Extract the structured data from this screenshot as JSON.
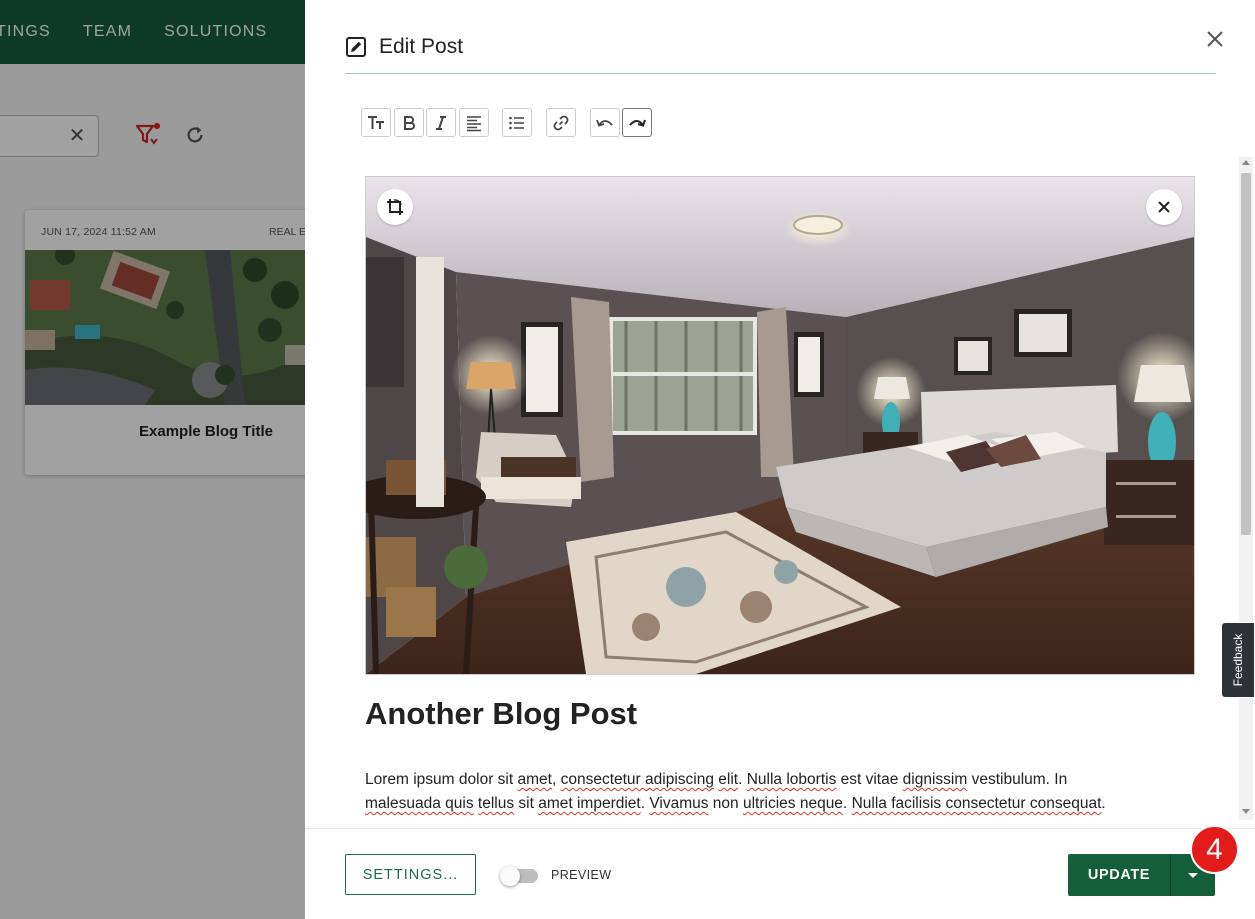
{
  "nav": {
    "items": [
      "TINGS",
      "TEAM",
      "SOLUTIONS"
    ]
  },
  "card": {
    "date": "JUN 17, 2024 11:52 AM",
    "category": "REAL E",
    "title": "Example Blog Title"
  },
  "editor": {
    "title": "Edit Post",
    "toolbar": [
      "text-size-icon",
      "bold-icon",
      "italic-icon",
      "align-icon",
      "list-icon",
      "link-icon",
      "undo-icon",
      "redo-icon"
    ],
    "post_title": "Another Blog Post",
    "post_body": {
      "line1_a": "Lorem ipsum dolor sit ",
      "line1_b": "amet",
      "line1_c": ", ",
      "line1_d": "consectetur adipiscing",
      "line1_e": " ",
      "line1_f": "elit",
      "line1_g": ". ",
      "line1_h": "Nulla lobortis",
      "line1_i": " est vitae ",
      "line1_j": "dignissim",
      "line1_k": " vestibulum. In",
      "line2_a": "malesuada quis",
      "line2_b": " ",
      "line2_c": "tellus",
      "line2_d": " sit ",
      "line2_e": "amet imperdiet",
      "line2_f": ". ",
      "line2_g": "Vivamus",
      "line2_h": " non ",
      "line2_i": "ultricies neque",
      "line2_j": ". ",
      "line2_k": "Nulla facilisis consectetur consequat",
      "line2_l": "."
    }
  },
  "footer": {
    "settings_label": "SETTINGS...",
    "preview_label": "PREVIEW",
    "update_label": "UPDATE"
  },
  "badge": "4",
  "feedback": "Feedback",
  "colors": {
    "brand_green": "#155e3b",
    "badge_red": "#e31b1b"
  }
}
